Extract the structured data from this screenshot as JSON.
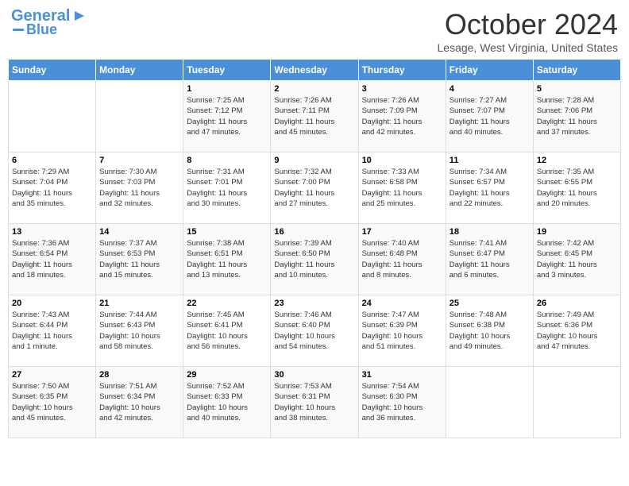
{
  "logo": {
    "line1": "General",
    "line2": "Blue"
  },
  "title": "October 2024",
  "location": "Lesage, West Virginia, United States",
  "days_header": [
    "Sunday",
    "Monday",
    "Tuesday",
    "Wednesday",
    "Thursday",
    "Friday",
    "Saturday"
  ],
  "weeks": [
    [
      {
        "day": "",
        "detail": ""
      },
      {
        "day": "",
        "detail": ""
      },
      {
        "day": "1",
        "detail": "Sunrise: 7:25 AM\nSunset: 7:12 PM\nDaylight: 11 hours\nand 47 minutes."
      },
      {
        "day": "2",
        "detail": "Sunrise: 7:26 AM\nSunset: 7:11 PM\nDaylight: 11 hours\nand 45 minutes."
      },
      {
        "day": "3",
        "detail": "Sunrise: 7:26 AM\nSunset: 7:09 PM\nDaylight: 11 hours\nand 42 minutes."
      },
      {
        "day": "4",
        "detail": "Sunrise: 7:27 AM\nSunset: 7:07 PM\nDaylight: 11 hours\nand 40 minutes."
      },
      {
        "day": "5",
        "detail": "Sunrise: 7:28 AM\nSunset: 7:06 PM\nDaylight: 11 hours\nand 37 minutes."
      }
    ],
    [
      {
        "day": "6",
        "detail": "Sunrise: 7:29 AM\nSunset: 7:04 PM\nDaylight: 11 hours\nand 35 minutes."
      },
      {
        "day": "7",
        "detail": "Sunrise: 7:30 AM\nSunset: 7:03 PM\nDaylight: 11 hours\nand 32 minutes."
      },
      {
        "day": "8",
        "detail": "Sunrise: 7:31 AM\nSunset: 7:01 PM\nDaylight: 11 hours\nand 30 minutes."
      },
      {
        "day": "9",
        "detail": "Sunrise: 7:32 AM\nSunset: 7:00 PM\nDaylight: 11 hours\nand 27 minutes."
      },
      {
        "day": "10",
        "detail": "Sunrise: 7:33 AM\nSunset: 6:58 PM\nDaylight: 11 hours\nand 25 minutes."
      },
      {
        "day": "11",
        "detail": "Sunrise: 7:34 AM\nSunset: 6:57 PM\nDaylight: 11 hours\nand 22 minutes."
      },
      {
        "day": "12",
        "detail": "Sunrise: 7:35 AM\nSunset: 6:55 PM\nDaylight: 11 hours\nand 20 minutes."
      }
    ],
    [
      {
        "day": "13",
        "detail": "Sunrise: 7:36 AM\nSunset: 6:54 PM\nDaylight: 11 hours\nand 18 minutes."
      },
      {
        "day": "14",
        "detail": "Sunrise: 7:37 AM\nSunset: 6:53 PM\nDaylight: 11 hours\nand 15 minutes."
      },
      {
        "day": "15",
        "detail": "Sunrise: 7:38 AM\nSunset: 6:51 PM\nDaylight: 11 hours\nand 13 minutes."
      },
      {
        "day": "16",
        "detail": "Sunrise: 7:39 AM\nSunset: 6:50 PM\nDaylight: 11 hours\nand 10 minutes."
      },
      {
        "day": "17",
        "detail": "Sunrise: 7:40 AM\nSunset: 6:48 PM\nDaylight: 11 hours\nand 8 minutes."
      },
      {
        "day": "18",
        "detail": "Sunrise: 7:41 AM\nSunset: 6:47 PM\nDaylight: 11 hours\nand 6 minutes."
      },
      {
        "day": "19",
        "detail": "Sunrise: 7:42 AM\nSunset: 6:45 PM\nDaylight: 11 hours\nand 3 minutes."
      }
    ],
    [
      {
        "day": "20",
        "detail": "Sunrise: 7:43 AM\nSunset: 6:44 PM\nDaylight: 11 hours\nand 1 minute."
      },
      {
        "day": "21",
        "detail": "Sunrise: 7:44 AM\nSunset: 6:43 PM\nDaylight: 10 hours\nand 58 minutes."
      },
      {
        "day": "22",
        "detail": "Sunrise: 7:45 AM\nSunset: 6:41 PM\nDaylight: 10 hours\nand 56 minutes."
      },
      {
        "day": "23",
        "detail": "Sunrise: 7:46 AM\nSunset: 6:40 PM\nDaylight: 10 hours\nand 54 minutes."
      },
      {
        "day": "24",
        "detail": "Sunrise: 7:47 AM\nSunset: 6:39 PM\nDaylight: 10 hours\nand 51 minutes."
      },
      {
        "day": "25",
        "detail": "Sunrise: 7:48 AM\nSunset: 6:38 PM\nDaylight: 10 hours\nand 49 minutes."
      },
      {
        "day": "26",
        "detail": "Sunrise: 7:49 AM\nSunset: 6:36 PM\nDaylight: 10 hours\nand 47 minutes."
      }
    ],
    [
      {
        "day": "27",
        "detail": "Sunrise: 7:50 AM\nSunset: 6:35 PM\nDaylight: 10 hours\nand 45 minutes."
      },
      {
        "day": "28",
        "detail": "Sunrise: 7:51 AM\nSunset: 6:34 PM\nDaylight: 10 hours\nand 42 minutes."
      },
      {
        "day": "29",
        "detail": "Sunrise: 7:52 AM\nSunset: 6:33 PM\nDaylight: 10 hours\nand 40 minutes."
      },
      {
        "day": "30",
        "detail": "Sunrise: 7:53 AM\nSunset: 6:31 PM\nDaylight: 10 hours\nand 38 minutes."
      },
      {
        "day": "31",
        "detail": "Sunrise: 7:54 AM\nSunset: 6:30 PM\nDaylight: 10 hours\nand 36 minutes."
      },
      {
        "day": "",
        "detail": ""
      },
      {
        "day": "",
        "detail": ""
      }
    ]
  ]
}
